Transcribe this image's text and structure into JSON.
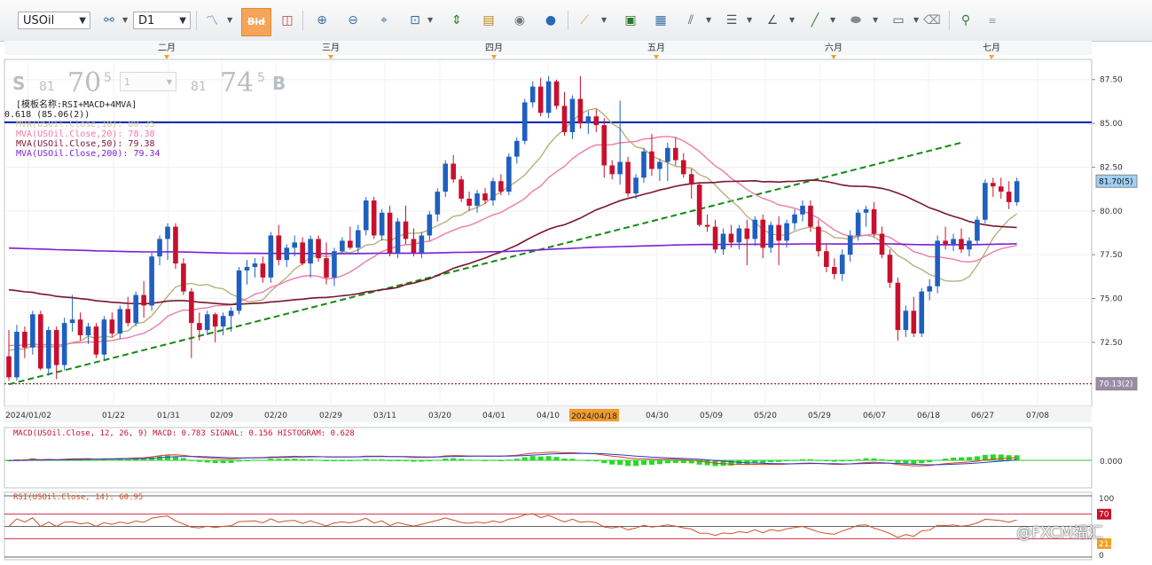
{
  "toolbar": {
    "symbol": "USOil",
    "timeframe": "D1",
    "bid_label": "Bid",
    "icons": [
      "chart-type-icon",
      "bid-ask-icon",
      "ask-icon",
      "zoom-in-icon",
      "zoom-out-icon",
      "crosshair-icon",
      "zoom-range-icon",
      "fit-icon",
      "properties-icon",
      "eye-icon",
      "globe-icon",
      "ruler-icon",
      "image-icon",
      "chart-image-icon",
      "fibonacci-icon",
      "lines-icon",
      "trendline-icon",
      "line-draw-icon",
      "shape-icon",
      "comment-icon",
      "eraser-icon",
      "hierarchy-icon",
      "menu-icon"
    ]
  },
  "trade_panel": {
    "sell_label": "S",
    "sell_small": "81",
    "sell_big": "70",
    "sell_sup": "5",
    "qty": "1",
    "buy_small": "81",
    "buy_big": "74",
    "buy_sup": "5",
    "buy_label": "B"
  },
  "overlay_labels": {
    "template": "[模板名称:RSI+MACD+4MVA]",
    "hline": "0.618 (85.06(2))",
    "mva10": "MVA(USOil.Close,10): 80.35",
    "mva20": "MVA(USOil.Close,20): 78.38",
    "mva50": "MVA(USOil.Close,50): 79.38",
    "mva200": "MVA(USOil.Close,200): 79.34"
  },
  "months": [
    {
      "label": "二月",
      "x": 188
    },
    {
      "label": "三月",
      "x": 373
    },
    {
      "label": "四月",
      "x": 557
    },
    {
      "label": "五月",
      "x": 740
    },
    {
      "label": "六月",
      "x": 940
    },
    {
      "label": "七月",
      "x": 1118
    }
  ],
  "date_axis": [
    {
      "label": "2024/01/02",
      "x": 32
    },
    {
      "label": "01/22",
      "x": 128
    },
    {
      "label": "01/31",
      "x": 190
    },
    {
      "label": "02/09",
      "x": 250
    },
    {
      "label": "02/20",
      "x": 311
    },
    {
      "label": "02/29",
      "x": 373
    },
    {
      "label": "03/11",
      "x": 434
    },
    {
      "label": "03/20",
      "x": 496
    },
    {
      "label": "04/01",
      "x": 557
    },
    {
      "label": "04/10",
      "x": 618
    },
    {
      "label": "04/30",
      "x": 741
    },
    {
      "label": "05/09",
      "x": 802
    },
    {
      "label": "05/20",
      "x": 863
    },
    {
      "label": "05/29",
      "x": 924
    },
    {
      "label": "06/07",
      "x": 986
    },
    {
      "label": "06/18",
      "x": 1047
    },
    {
      "label": "06/27",
      "x": 1108
    },
    {
      "label": "07/08",
      "x": 1170
    }
  ],
  "highlight_date": "2024/04/18",
  "price_axis": [
    "87.50",
    "85.00",
    "82.50",
    "80.00",
    "77.50",
    "75.00",
    "72.50"
  ],
  "price_tag_current": "81.70(5)",
  "price_tag_low": "70.13(2)",
  "macd_label": "MACD(USOil.Close, 12, 26, 9)  MACD: 0.783  SIGNAL: 0.156  HISTOGRAM: 0.628",
  "macd_axis": "0.000",
  "rsi_label": "RSI(USOil.Close, 14): 60.95",
  "rsi_axis": {
    "top": "100",
    "upper": "70",
    "lower": "21.99",
    "bottom": "0"
  },
  "watermark": "@FXCM福汇",
  "colors": {
    "up": "#1f5fbf",
    "down": "#c8102e",
    "trend": "#138a13",
    "hline": "#0a1fb8",
    "mva200": "#7a1fd6",
    "mva50": "#7a1530",
    "mva20": "#f07aa8",
    "mva10": "#b8b07a"
  },
  "chart_data": {
    "type": "candlestick",
    "ylim": [
      69,
      88.5
    ],
    "hline": 85.06,
    "low_line": 70.13,
    "trendline": {
      "start": [
        0,
        70.1
      ],
      "end": [
        120,
        83.9
      ]
    },
    "candles": [
      [
        71.7,
        73.2,
        70.3,
        70.5
      ],
      [
        70.5,
        73.5,
        70.3,
        73.1
      ],
      [
        73.1,
        73.4,
        71.6,
        72.2
      ],
      [
        72.2,
        74.3,
        71.8,
        74.1
      ],
      [
        74.1,
        74.3,
        70.9,
        71.0
      ],
      [
        71.0,
        73.4,
        70.6,
        73.2
      ],
      [
        73.2,
        73.4,
        70.4,
        71.2
      ],
      [
        71.2,
        73.9,
        70.9,
        73.6
      ],
      [
        73.6,
        75.2,
        73.1,
        73.8
      ],
      [
        73.8,
        74.2,
        72.6,
        72.9
      ],
      [
        72.9,
        73.6,
        72.4,
        73.4
      ],
      [
        73.4,
        73.6,
        71.6,
        71.8
      ],
      [
        71.8,
        74.0,
        71.5,
        73.8
      ],
      [
        73.8,
        74.2,
        72.8,
        73.0
      ],
      [
        73.0,
        74.6,
        72.7,
        74.4
      ],
      [
        74.4,
        75.1,
        73.4,
        73.6
      ],
      [
        73.6,
        75.4,
        73.4,
        75.2
      ],
      [
        75.2,
        76.0,
        73.9,
        74.6
      ],
      [
        74.6,
        77.6,
        74.3,
        77.4
      ],
      [
        77.4,
        78.6,
        76.9,
        78.4
      ],
      [
        78.4,
        79.3,
        77.2,
        79.1
      ],
      [
        79.1,
        79.3,
        76.7,
        77.0
      ],
      [
        77.0,
        77.3,
        75.2,
        75.4
      ],
      [
        75.4,
        75.6,
        71.6,
        73.6
      ],
      [
        73.6,
        74.2,
        72.6,
        73.2
      ],
      [
        73.2,
        74.3,
        72.9,
        74.1
      ],
      [
        74.1,
        74.2,
        72.5,
        73.4
      ],
      [
        73.4,
        74.2,
        72.9,
        74.0
      ],
      [
        74.0,
        74.5,
        73.1,
        74.3
      ],
      [
        74.3,
        76.8,
        74.1,
        76.6
      ],
      [
        76.6,
        77.2,
        75.8,
        76.8
      ],
      [
        76.8,
        77.3,
        76.2,
        77.0
      ],
      [
        77.0,
        77.4,
        75.9,
        76.2
      ],
      [
        76.2,
        78.8,
        75.9,
        78.6
      ],
      [
        78.6,
        79.2,
        76.9,
        77.2
      ],
      [
        77.2,
        78.1,
        76.8,
        77.9
      ],
      [
        77.9,
        78.6,
        77.4,
        78.2
      ],
      [
        78.2,
        78.5,
        76.9,
        77.0
      ],
      [
        77.0,
        78.6,
        76.2,
        78.4
      ],
      [
        78.4,
        78.6,
        77.1,
        77.3
      ],
      [
        77.3,
        78.2,
        75.8,
        76.2
      ],
      [
        76.2,
        77.9,
        75.7,
        77.7
      ],
      [
        77.7,
        78.5,
        77.6,
        78.3
      ],
      [
        78.3,
        79.1,
        77.8,
        77.9
      ],
      [
        77.9,
        79.2,
        77.6,
        78.9
      ],
      [
        78.9,
        80.8,
        78.6,
        80.6
      ],
      [
        80.6,
        80.8,
        78.4,
        78.6
      ],
      [
        78.6,
        80.1,
        78.3,
        79.9
      ],
      [
        79.9,
        80.3,
        77.4,
        77.6
      ],
      [
        77.6,
        79.6,
        77.3,
        79.4
      ],
      [
        79.4,
        80.3,
        78.1,
        78.4
      ],
      [
        78.4,
        79.0,
        77.4,
        77.6
      ],
      [
        77.6,
        78.8,
        77.3,
        78.6
      ],
      [
        78.6,
        80.0,
        78.3,
        79.8
      ],
      [
        79.8,
        81.3,
        79.4,
        81.1
      ],
      [
        81.1,
        82.9,
        80.8,
        82.7
      ],
      [
        82.7,
        83.2,
        81.6,
        81.8
      ],
      [
        81.8,
        82.0,
        80.5,
        80.7
      ],
      [
        80.7,
        81.1,
        80.0,
        80.3
      ],
      [
        80.3,
        81.2,
        79.9,
        81.0
      ],
      [
        81.0,
        81.3,
        80.4,
        80.6
      ],
      [
        80.6,
        81.9,
        80.3,
        81.7
      ],
      [
        81.7,
        82.1,
        80.9,
        81.1
      ],
      [
        81.1,
        83.3,
        80.9,
        83.1
      ],
      [
        83.1,
        84.2,
        82.7,
        84.0
      ],
      [
        84.0,
        86.4,
        83.8,
        86.2
      ],
      [
        86.2,
        87.4,
        85.9,
        87.1
      ],
      [
        87.1,
        87.6,
        85.4,
        85.6
      ],
      [
        85.6,
        87.7,
        85.3,
        87.4
      ],
      [
        87.4,
        87.5,
        85.8,
        86.0
      ],
      [
        86.0,
        86.8,
        84.3,
        84.5
      ],
      [
        84.5,
        86.6,
        84.1,
        86.4
      ],
      [
        86.4,
        87.7,
        84.7,
        85.0
      ],
      [
        85.0,
        85.7,
        84.4,
        85.4
      ],
      [
        85.4,
        85.8,
        84.5,
        84.9
      ],
      [
        84.9,
        85.3,
        81.9,
        82.6
      ],
      [
        82.6,
        82.9,
        81.8,
        82.1
      ],
      [
        82.1,
        86.3,
        81.5,
        82.8
      ],
      [
        82.8,
        83.1,
        80.8,
        81.0
      ],
      [
        81.0,
        82.1,
        80.7,
        81.9
      ],
      [
        81.9,
        83.6,
        81.6,
        83.4
      ],
      [
        83.4,
        84.4,
        82.0,
        82.4
      ],
      [
        82.4,
        83.0,
        81.7,
        82.8
      ],
      [
        82.8,
        83.9,
        81.7,
        83.6
      ],
      [
        83.6,
        84.2,
        82.6,
        82.9
      ],
      [
        82.9,
        83.3,
        81.9,
        82.1
      ],
      [
        82.1,
        82.4,
        80.7,
        81.5
      ],
      [
        81.5,
        81.6,
        79.1,
        79.2
      ],
      [
        79.2,
        79.8,
        78.8,
        79.1
      ],
      [
        79.1,
        79.5,
        77.6,
        77.8
      ],
      [
        77.8,
        79.0,
        77.5,
        78.7
      ],
      [
        78.7,
        79.2,
        77.9,
        78.2
      ],
      [
        78.2,
        79.2,
        77.8,
        79.0
      ],
      [
        79.0,
        79.5,
        76.9,
        78.4
      ],
      [
        78.4,
        79.7,
        78.0,
        79.5
      ],
      [
        79.5,
        79.8,
        77.3,
        77.9
      ],
      [
        77.9,
        79.4,
        77.6,
        79.2
      ],
      [
        79.2,
        79.7,
        76.9,
        78.3
      ],
      [
        78.3,
        79.5,
        77.9,
        79.3
      ],
      [
        79.3,
        80.1,
        78.9,
        79.8
      ],
      [
        79.8,
        80.6,
        79.4,
        80.3
      ],
      [
        80.3,
        80.6,
        78.8,
        79.1
      ],
      [
        79.1,
        79.5,
        77.4,
        77.7
      ],
      [
        77.7,
        78.1,
        76.5,
        76.8
      ],
      [
        76.8,
        77.3,
        76.1,
        76.4
      ],
      [
        76.4,
        77.8,
        76.0,
        77.5
      ],
      [
        77.5,
        78.9,
        77.1,
        78.6
      ],
      [
        78.6,
        80.1,
        78.3,
        79.9
      ],
      [
        79.9,
        80.3,
        79.1,
        80.1
      ],
      [
        80.1,
        80.5,
        78.5,
        78.7
      ],
      [
        78.7,
        79.1,
        77.3,
        77.5
      ],
      [
        77.5,
        77.8,
        75.6,
        75.9
      ],
      [
        75.9,
        76.2,
        72.6,
        73.2
      ],
      [
        73.2,
        74.6,
        72.8,
        74.3
      ],
      [
        74.3,
        75.1,
        72.8,
        73.0
      ],
      [
        73.0,
        75.6,
        72.8,
        75.4
      ],
      [
        75.4,
        76.1,
        74.9,
        75.7
      ],
      [
        75.7,
        78.6,
        75.3,
        78.3
      ],
      [
        78.3,
        79.1,
        77.8,
        78.1
      ],
      [
        78.1,
        78.7,
        77.7,
        78.4
      ],
      [
        78.4,
        79.0,
        77.6,
        77.8
      ],
      [
        77.8,
        78.5,
        77.4,
        78.3
      ],
      [
        78.3,
        79.7,
        78.1,
        79.5
      ],
      [
        79.5,
        81.8,
        79.3,
        81.6
      ],
      [
        81.6,
        81.9,
        80.8,
        81.4
      ],
      [
        81.4,
        81.9,
        80.7,
        81.1
      ],
      [
        81.1,
        81.7,
        80.1,
        80.5
      ],
      [
        80.5,
        81.9,
        80.3,
        81.7
      ]
    ]
  }
}
